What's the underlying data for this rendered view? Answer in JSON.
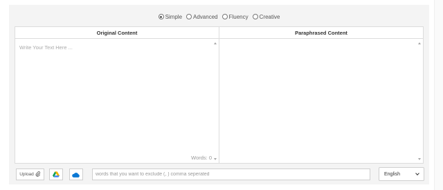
{
  "modes": {
    "options": [
      {
        "label": "Simple",
        "selected": true
      },
      {
        "label": "Advanced",
        "selected": false
      },
      {
        "label": "Fluency",
        "selected": false
      },
      {
        "label": "Creative",
        "selected": false
      }
    ]
  },
  "original": {
    "header": "Original Content",
    "placeholder": "Write Your Text Here ...",
    "word_count": "Words: 0"
  },
  "paraphrased": {
    "header": "Paraphrased Content"
  },
  "toolbar": {
    "upload_label": "Upload",
    "exclude_placeholder": "words that you want to exclude (, ) comma seperated",
    "language": "English"
  },
  "icons": {
    "upload": "paperclip-icon",
    "drive": "google-drive-icon",
    "onedrive": "onedrive-icon"
  },
  "colors": {
    "drive_yellow": "#f4b400",
    "drive_green": "#0f9d58",
    "drive_blue": "#4285f4",
    "onedrive_blue": "#0b78d4"
  }
}
